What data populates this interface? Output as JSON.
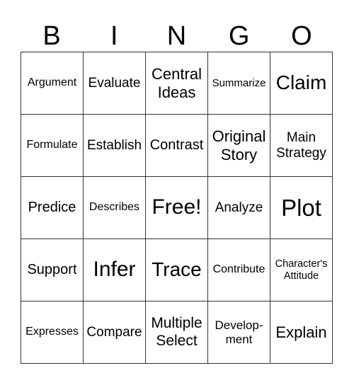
{
  "header": [
    "B",
    "I",
    "N",
    "G",
    "O"
  ],
  "cells": [
    [
      "Argument",
      "Evaluate",
      "Central Ideas",
      "Summarize",
      "Claim"
    ],
    [
      "Formulate",
      "Establish",
      "Contrast",
      "Original Story",
      "Main Strategy"
    ],
    [
      "Predice",
      "Describes",
      "Free!",
      "Analyze",
      "Plot"
    ],
    [
      "Support",
      "Infer",
      "Trace",
      "Contribute",
      "Character's Attitude"
    ],
    [
      "Expresses",
      "Compare",
      "Multiple Select",
      "Develop- ment",
      "Explain"
    ]
  ]
}
